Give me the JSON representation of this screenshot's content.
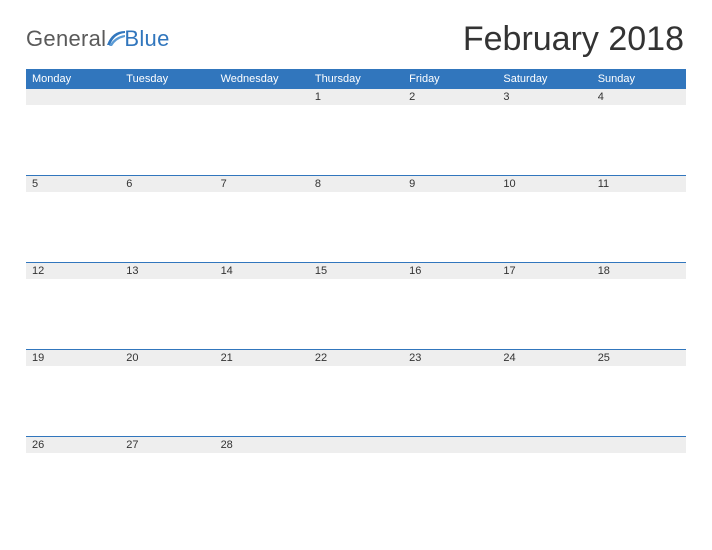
{
  "brand": {
    "word1": "General",
    "word2": "Blue",
    "accent_color": "#3176bd",
    "text_color": "#5a5a5a"
  },
  "title": "February 2018",
  "day_headers": [
    "Monday",
    "Tuesday",
    "Wednesday",
    "Thursday",
    "Friday",
    "Saturday",
    "Sunday"
  ],
  "weeks": [
    [
      "",
      "",
      "",
      "1",
      "2",
      "3",
      "4"
    ],
    [
      "5",
      "6",
      "7",
      "8",
      "9",
      "10",
      "11"
    ],
    [
      "12",
      "13",
      "14",
      "15",
      "16",
      "17",
      "18"
    ],
    [
      "19",
      "20",
      "21",
      "22",
      "23",
      "24",
      "25"
    ],
    [
      "26",
      "27",
      "28",
      "",
      "",
      "",
      ""
    ]
  ]
}
